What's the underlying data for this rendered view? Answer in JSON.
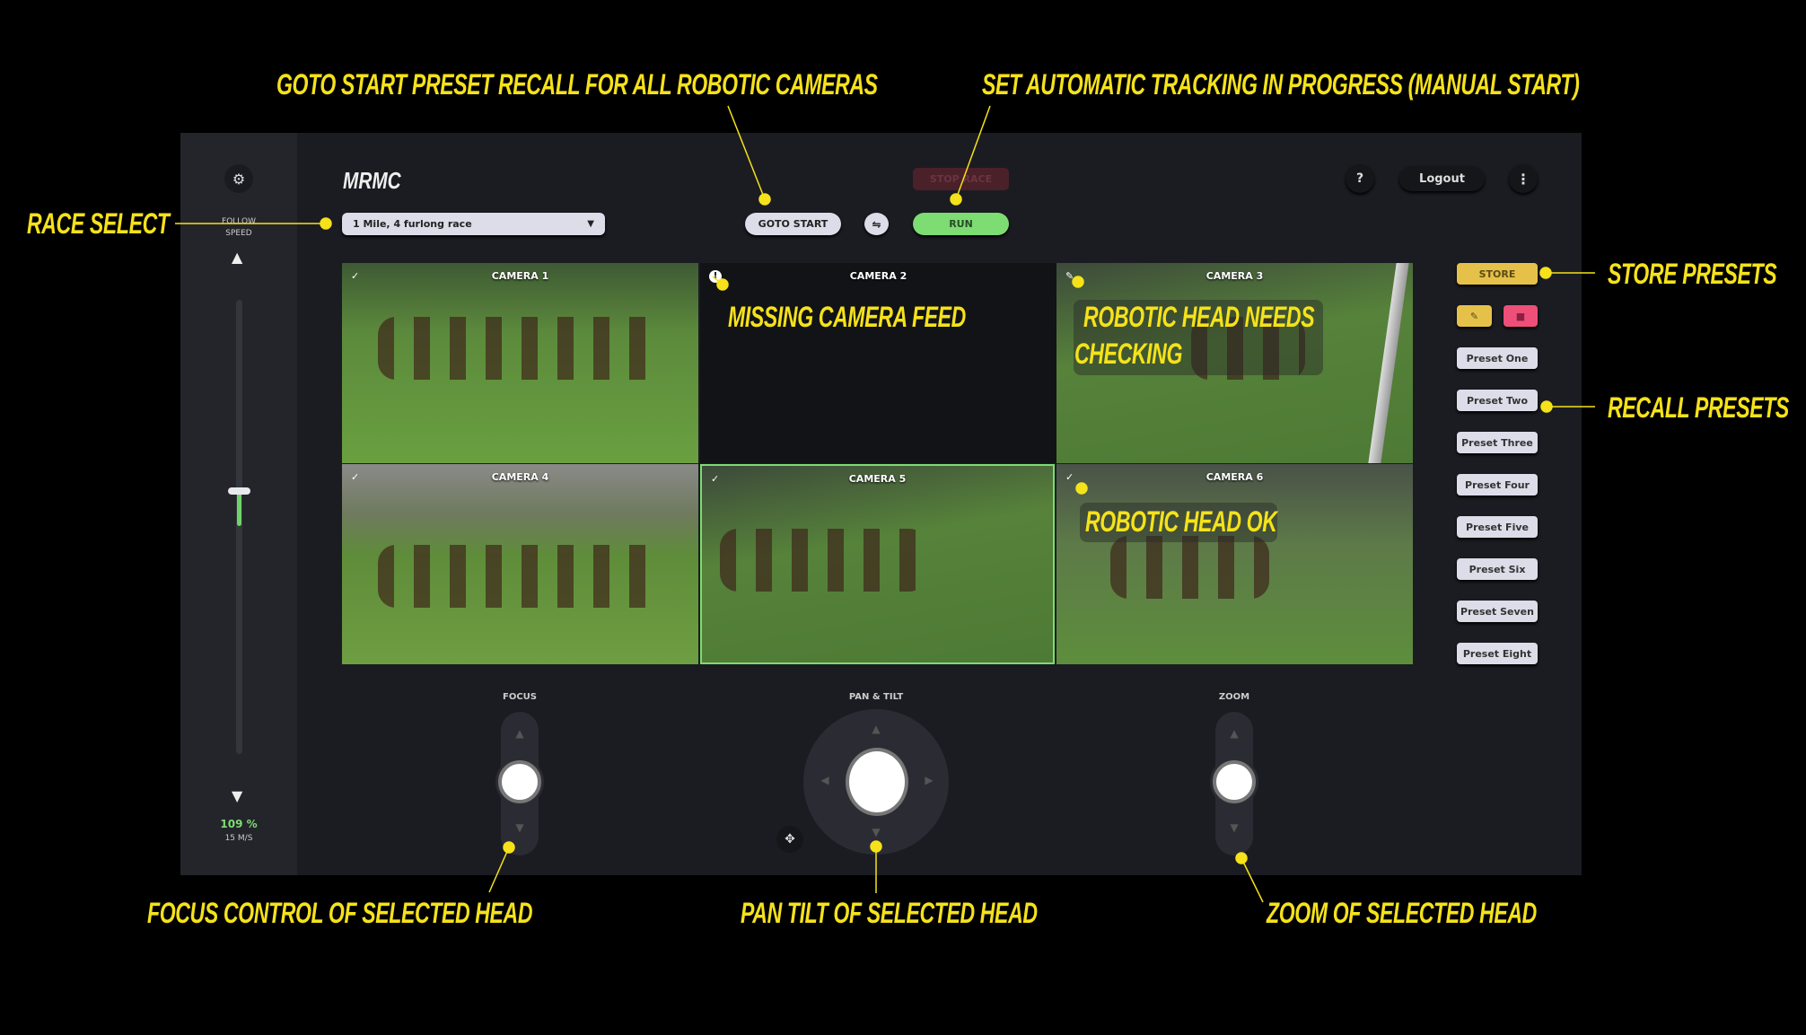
{
  "annotations": {
    "goto_start": "GOTO START PRESET RECALL FOR ALL ROBOTIC CAMERAS",
    "tracking": "SET AUTOMATIC TRACKING IN PROGRESS (MANUAL START)",
    "race_select": "RACE SELECT",
    "store_presets": "STORE PRESETS",
    "recall_presets": "RECALL PRESETS",
    "missing_feed": "MISSING CAMERA FEED",
    "needs_checking_1": "ROBOTIC HEAD NEEDS",
    "needs_checking_2": "CHECKING",
    "head_ok": "ROBOTIC HEAD OK",
    "focus": "FOCUS CONTROL OF SELECTED HEAD",
    "pan_tilt": "PAN TILT OF SELECTED HEAD",
    "zoom": "ZOOM OF SELECTED HEAD"
  },
  "header": {
    "logo": "MRMC",
    "race_dropdown_value": "1 Mile, 4 furlong race",
    "goto_start": "GOTO START",
    "stop_race": "STOP RACE",
    "run": "RUN",
    "help": "?",
    "logout": "Logout"
  },
  "sidebar": {
    "follow_speed_1": "FOLLOW",
    "follow_speed_2": "SPEED",
    "speed_percent": "109 %",
    "speed_ms": "15 M/S",
    "speed_value_percent": 109
  },
  "cameras": [
    {
      "label": "CAMERA 1",
      "status": "ok"
    },
    {
      "label": "CAMERA 2",
      "status": "missing"
    },
    {
      "label": "CAMERA 3",
      "status": "needs-checking"
    },
    {
      "label": "CAMERA 4",
      "status": "ok"
    },
    {
      "label": "CAMERA 5",
      "status": "ok",
      "selected": true
    },
    {
      "label": "CAMERA 6",
      "status": "ok"
    }
  ],
  "presets": {
    "store": "STORE",
    "items": [
      "Preset One",
      "Preset Two",
      "Preset Three",
      "Preset Four",
      "Preset Five",
      "Preset Six",
      "Preset Seven",
      "Preset Eight"
    ]
  },
  "controls": {
    "focus": "FOCUS",
    "pan_tilt": "PAN & TILT",
    "zoom": "ZOOM"
  },
  "colors": {
    "accent_yellow": "#f5e21a",
    "run_green": "#7ddc72",
    "store_gold": "#e6c14a",
    "delete_pink": "#ee4f78",
    "stop_red": "#5a2530"
  }
}
